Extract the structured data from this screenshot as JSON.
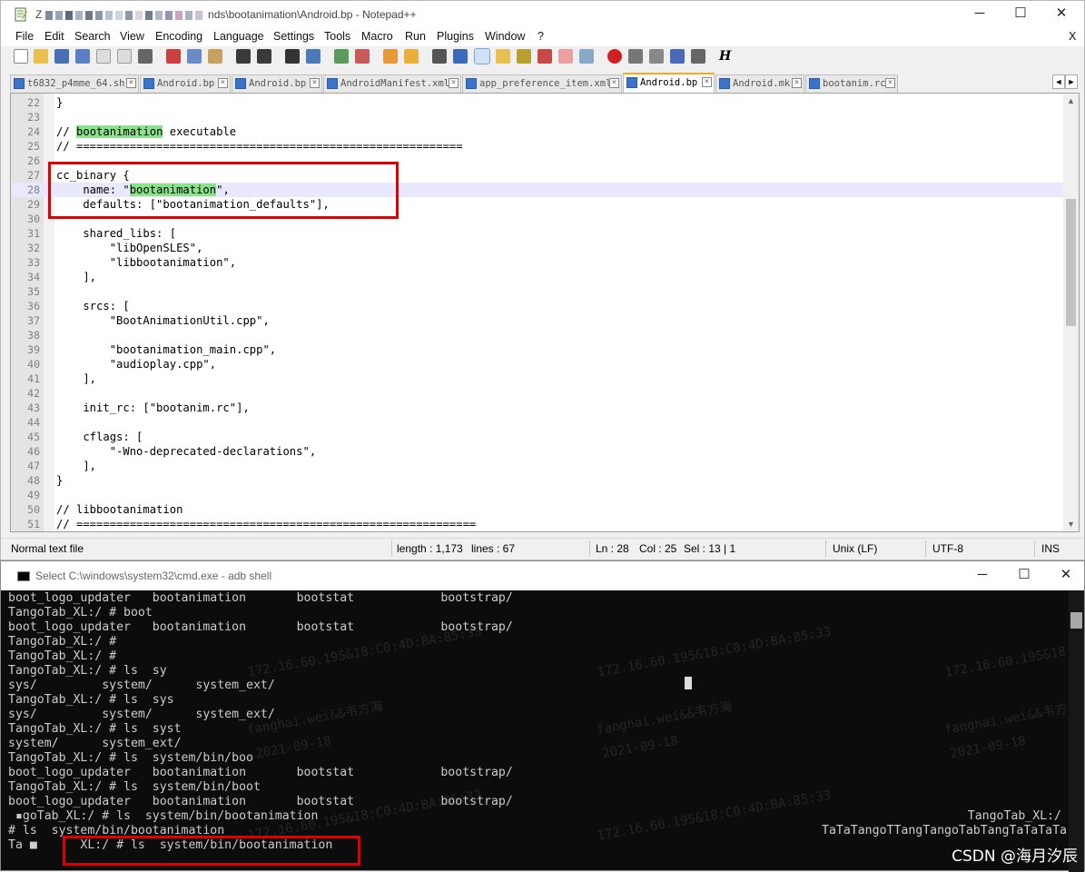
{
  "notepad": {
    "title_prefix": "Z",
    "title": "nds\\bootanimation\\Android.bp - Notepad++",
    "window_controls": {
      "minimize": "─",
      "maximize": "☐",
      "close": "✕"
    },
    "menu": [
      "File",
      "Edit",
      "Search",
      "View",
      "Encoding",
      "Language",
      "Settings",
      "Tools",
      "Macro",
      "Run",
      "Plugins",
      "Window",
      "?"
    ],
    "menu_close": "X",
    "tabs": [
      {
        "label": "t6832_p4mme_64.sh",
        "active": false
      },
      {
        "label": "Android.bp",
        "active": false
      },
      {
        "label": "Android.bp",
        "active": false
      },
      {
        "label": "AndroidManifest.xml",
        "active": false
      },
      {
        "label": "app_preference_item.xml",
        "active": false
      },
      {
        "label": "Android.bp",
        "active": true
      },
      {
        "label": "Android.mk",
        "active": false
      },
      {
        "label": "bootanim.rc",
        "active": false
      }
    ],
    "tab_close": "×",
    "tab_nav": {
      "left": "◄",
      "right": "►",
      "close": "×"
    },
    "code_lines": [
      {
        "n": "22",
        "text": "}"
      },
      {
        "n": "23",
        "text": ""
      },
      {
        "n": "24",
        "pre": "// ",
        "hl": "bootanimation",
        "post": " executable"
      },
      {
        "n": "25",
        "text": "// =========================================================="
      },
      {
        "n": "26",
        "text": ""
      },
      {
        "n": "27",
        "text": "cc_binary {"
      },
      {
        "n": "28",
        "pre": "    name: \"",
        "hl": "bootanimation",
        "post": "\",",
        "current": true
      },
      {
        "n": "29",
        "text": "    defaults: [\"bootanimation_defaults\"],"
      },
      {
        "n": "30",
        "text": ""
      },
      {
        "n": "31",
        "text": "    shared_libs: ["
      },
      {
        "n": "32",
        "text": "        \"libOpenSLES\","
      },
      {
        "n": "33",
        "text": "        \"libbootanimation\","
      },
      {
        "n": "34",
        "text": "    ],"
      },
      {
        "n": "35",
        "text": ""
      },
      {
        "n": "36",
        "text": "    srcs: ["
      },
      {
        "n": "37",
        "text": "        \"BootAnimationUtil.cpp\","
      },
      {
        "n": "38",
        "text": ""
      },
      {
        "n": "39",
        "text": "        \"bootanimation_main.cpp\","
      },
      {
        "n": "40",
        "text": "        \"audioplay.cpp\","
      },
      {
        "n": "41",
        "text": "    ],"
      },
      {
        "n": "42",
        "text": ""
      },
      {
        "n": "43",
        "text": "    init_rc: [\"bootanim.rc\"],"
      },
      {
        "n": "44",
        "text": ""
      },
      {
        "n": "45",
        "text": "    cflags: ["
      },
      {
        "n": "46",
        "text": "        \"-Wno-deprecated-declarations\","
      },
      {
        "n": "47",
        "text": "    ],"
      },
      {
        "n": "48",
        "text": "}"
      },
      {
        "n": "49",
        "text": ""
      },
      {
        "n": "50",
        "text": "// libbootanimation"
      },
      {
        "n": "51",
        "text": "// ============================================================"
      }
    ],
    "status": {
      "file_type": "Normal text file",
      "length": "length : 1,173",
      "lines": "lines : 67",
      "ln": "Ln : 28",
      "col": "Col : 25",
      "sel": "Sel : 13 | 1",
      "eol": "Unix (LF)",
      "encoding": "UTF-8",
      "mode": "INS"
    }
  },
  "cmd": {
    "title": "Select C:\\windows\\system32\\cmd.exe - adb  shell",
    "window_controls": {
      "minimize": "─",
      "maximize": "☐",
      "close": "✕"
    },
    "lines": [
      "boot_logo_updater   bootanimation       bootstat            bootstrap/",
      "TangoTab_XL:/ # boot",
      "boot_logo_updater   bootanimation       bootstat            bootstrap/",
      "TangoTab_XL:/ #",
      "TangoTab_XL:/ #",
      "TangoTab_XL:/ # ls  sy",
      "sys/         system/      system_ext/",
      "TangoTab_XL:/ # ls  sys",
      "sys/         system/      system_ext/",
      "TangoTab_XL:/ # ls  syst",
      "system/      system_ext/",
      "TangoTab_XL:/ # ls  system/bin/boo",
      "boot_logo_updater   bootanimation       bootstat            bootstrap/",
      "TangoTab_XL:/ # ls  system/bin/boot",
      "boot_logo_updater   bootanimation       bootstat            bootstrap/",
      " ▪goTab_XL:/ # ls  system/bin/bootanimation",
      "# ls  system/bin/bootanimation",
      "Ta ■      XL:/ # ls  system/bin/bootanimation"
    ],
    "right_lines": [
      "TangoTab_XL:/",
      "TaTaTangoTTangTangoTabTangTaTaTaTa"
    ],
    "watermarks": [
      "172.16.60.195&18:C0:4D:BA:85:33",
      "fanghai.wei&&韦方海",
      "2021-09-18"
    ]
  },
  "watermark_brand": "CSDN @海月汐辰"
}
